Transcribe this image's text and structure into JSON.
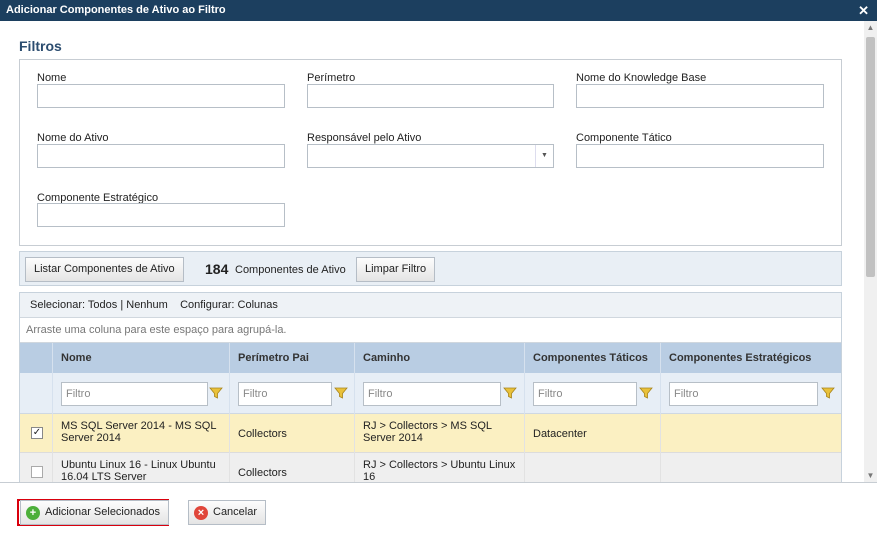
{
  "dialog": {
    "title": "Adicionar Componentes de Ativo ao Filtro",
    "close": "✕"
  },
  "filters": {
    "heading": "Filtros",
    "nome": "Nome",
    "perimetro": "Perímetro",
    "nome_kb": "Nome do Knowledge Base",
    "nome_ativo": "Nome do Ativo",
    "responsavel": "Responsável pelo Ativo",
    "componente_tatico": "Componente Tático",
    "componente_estrategico": "Componente Estratégico"
  },
  "toolbar": {
    "listar": "Listar Componentes de Ativo",
    "count": "184",
    "count_label": "Componentes de Ativo",
    "limpar": "Limpar Filtro"
  },
  "grid": {
    "selecionar": "Selecionar:",
    "todos": "Todos",
    "sep": "|",
    "nenhum": "Nenhum",
    "configurar": "Configurar:",
    "colunas": "Colunas",
    "group_hint": "Arraste uma coluna para este espaço para agrupá-la.",
    "headers": {
      "nome": "Nome",
      "perimetro": "Perímetro Pai",
      "caminho": "Caminho",
      "taticos": "Componentes Táticos",
      "estrategicos": "Componentes Estratégicos"
    },
    "filter_placeholder": "Filtro",
    "rows": [
      {
        "checked": "✓",
        "nome": "MS SQL Server 2014 - MS SQL Server 2014",
        "perimetro": "Collectors",
        "caminho": "RJ > Collectors > MS SQL Server 2014",
        "taticos": "Datacenter",
        "estrategicos": ""
      },
      {
        "checked": "",
        "nome": "Ubuntu Linux 16 - Linux Ubuntu 16.04 LTS Server",
        "perimetro": "Collectors",
        "caminho": "RJ > Collectors > Ubuntu Linux 16",
        "taticos": "",
        "estrategicos": ""
      }
    ]
  },
  "footer": {
    "adicionar": "Adicionar Selecionados",
    "cancelar": "Cancelar"
  },
  "colors": {
    "titlebar": "#1c3f5f",
    "selected_row": "#fbf0c2",
    "header": "#b9cde3",
    "highlight": "#d9000d"
  }
}
